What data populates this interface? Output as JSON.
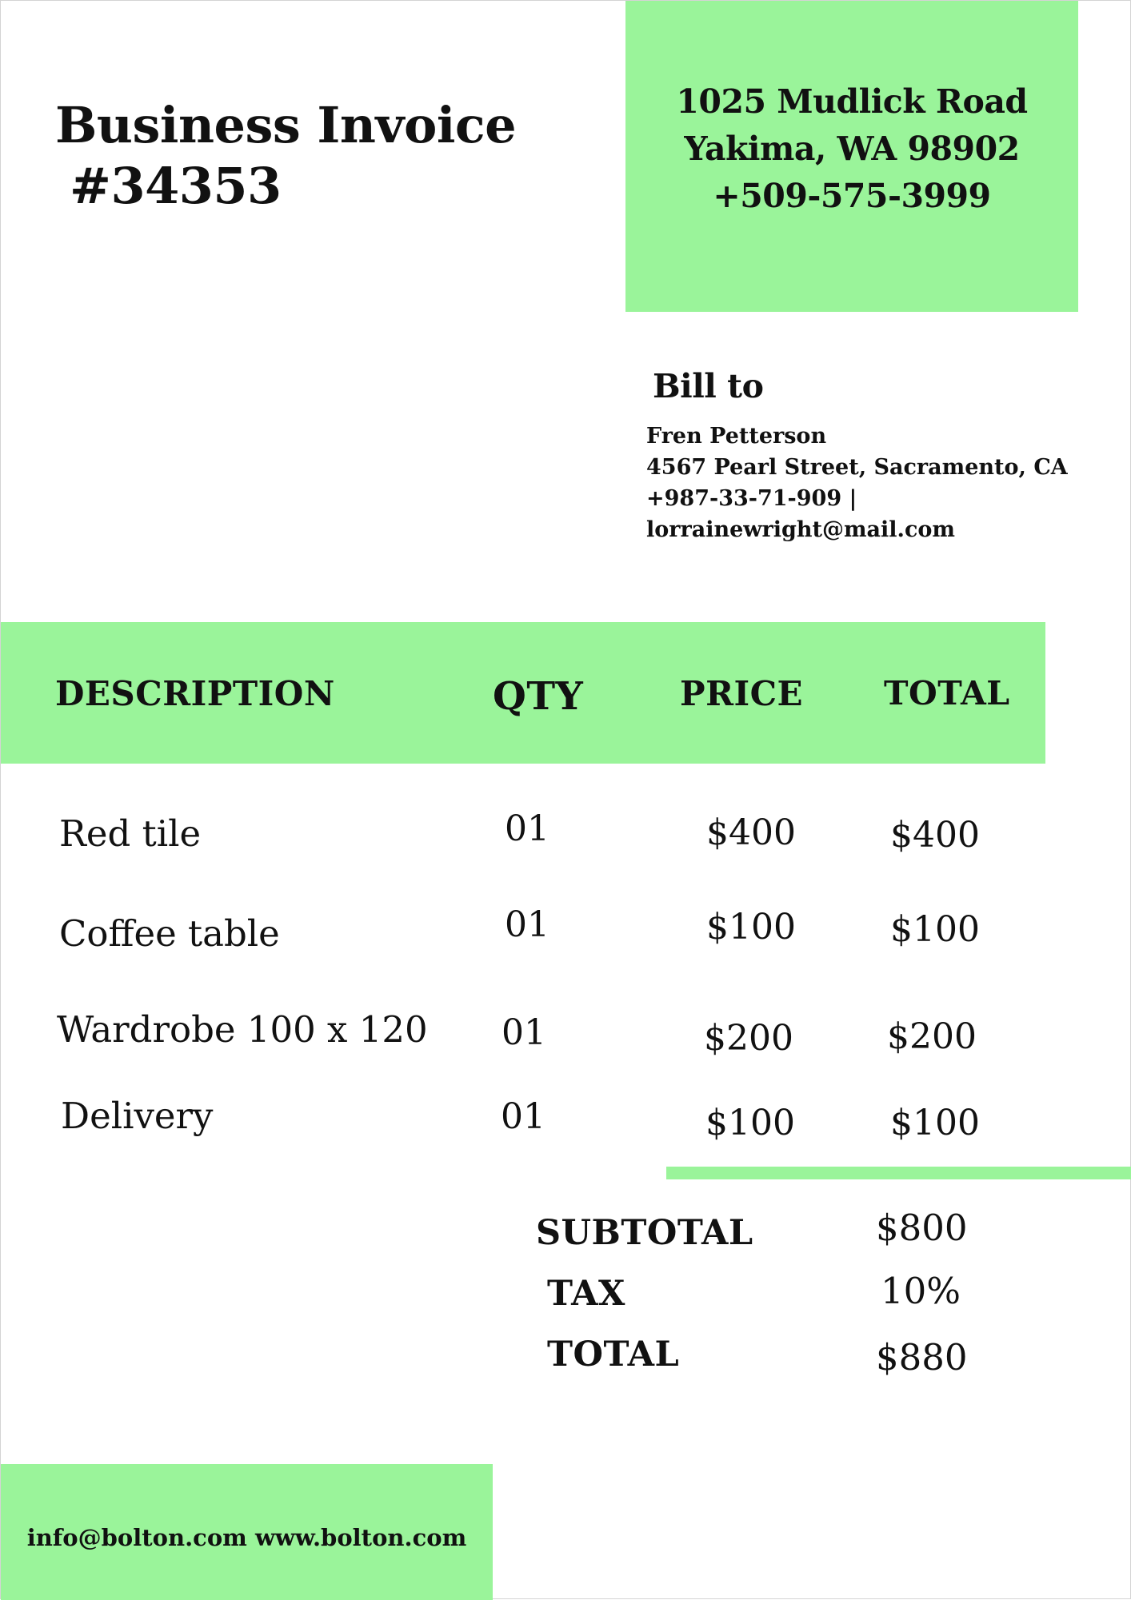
{
  "invoice": {
    "title": "Business Invoice",
    "number": "#34353"
  },
  "company": {
    "address_line1": "1025 Mudlick Road",
    "address_line2": "Yakima, WA 98902",
    "phone": "+509-575-3999"
  },
  "bill_to": {
    "heading": "Bill to",
    "name": "Fren Petterson",
    "address": "4567 Pearl Street, Sacramento, CA",
    "phone": "+987-33-71-909 |",
    "email": "lorrainewright@mail.com"
  },
  "table": {
    "headers": [
      "DESCRIPTION",
      "QTY",
      "PRICE",
      "TOTAL"
    ],
    "rows": [
      {
        "description": "Red tile",
        "qty": "01",
        "price": "$400",
        "total": "$400"
      },
      {
        "description": "Coffee table",
        "qty": "01",
        "price": "$100",
        "total": "$100"
      },
      {
        "description": "Wardrobe 100 x 120",
        "qty": "01",
        "price": "$200",
        "total": "$200"
      },
      {
        "description": "Delivery",
        "qty": "01",
        "price": "$100",
        "total": "$100"
      }
    ]
  },
  "summary": {
    "subtotal_label": "SUBTOTAL",
    "subtotal_value": "$800",
    "tax_label": "TAX",
    "tax_value": "10%",
    "total_label": "TOTAL",
    "total_value": "$880"
  },
  "footer": {
    "email": "info@bolton.com",
    "website": "www.bolton.com"
  },
  "colors": {
    "accent_green": "#9af49a",
    "text": "#111111",
    "background": "#ffffff"
  }
}
